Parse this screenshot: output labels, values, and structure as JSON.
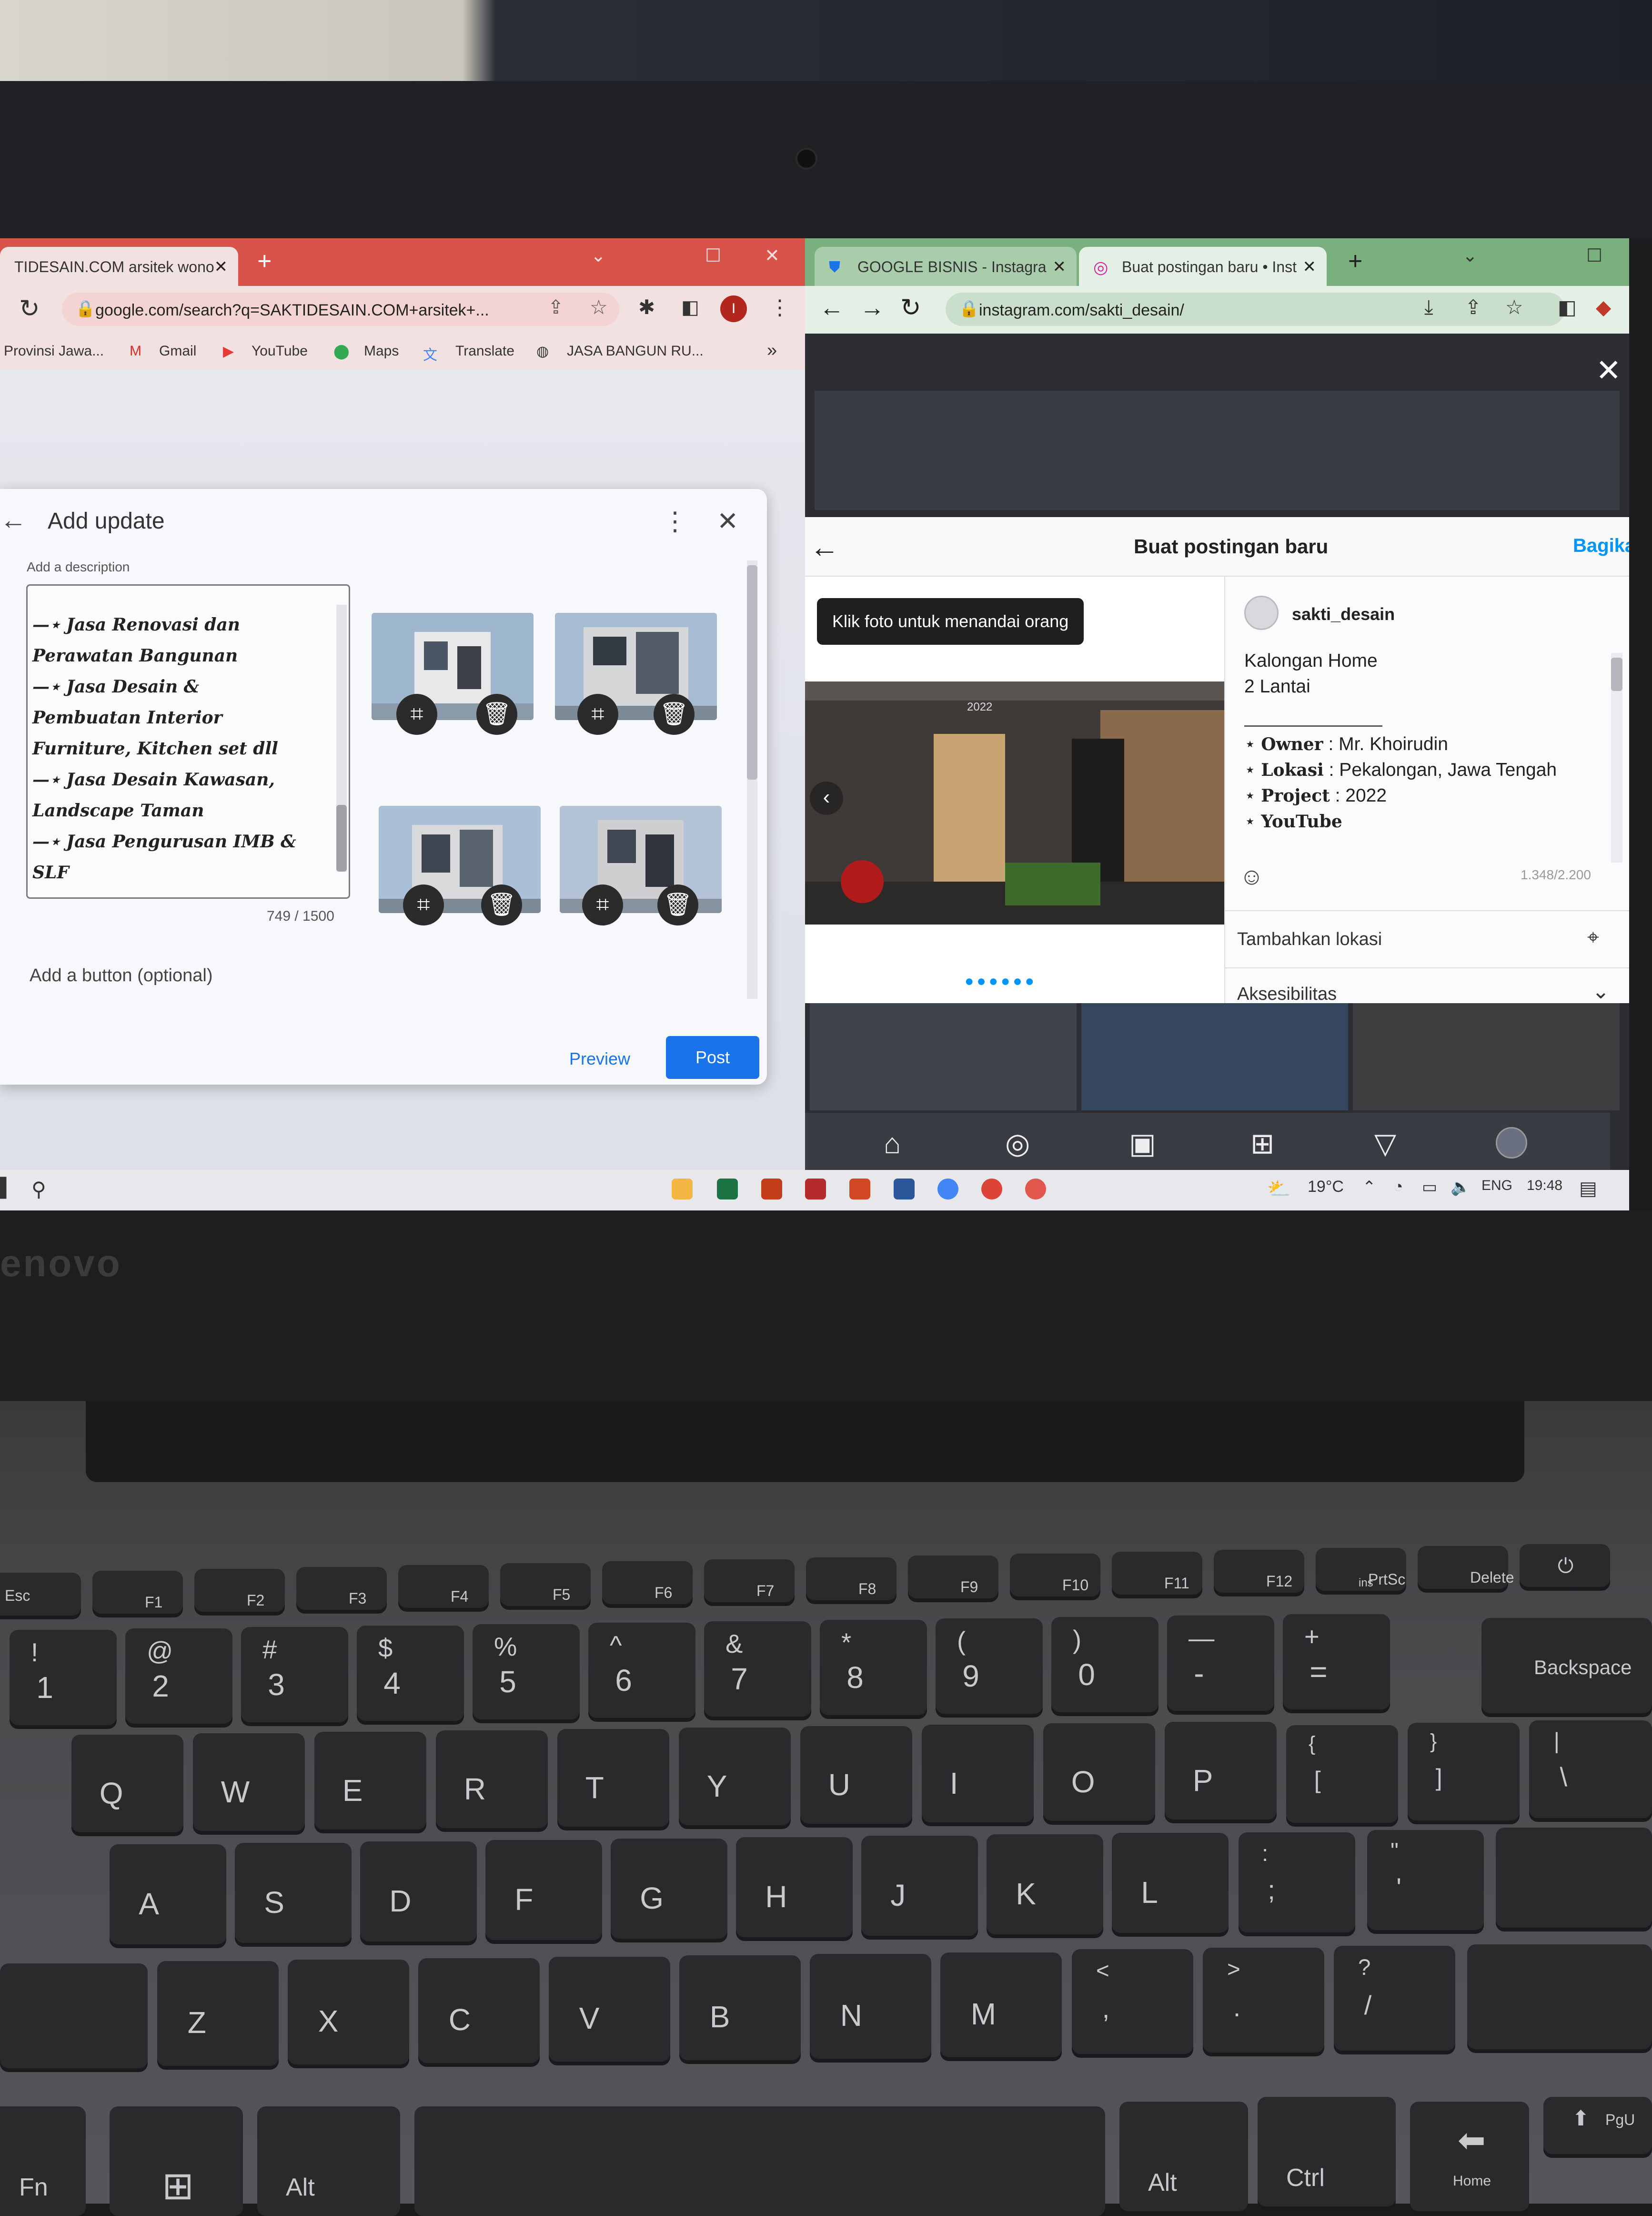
{
  "left_browser": {
    "tab_title": "TIDESAIN.COM arsitek wono",
    "address": "google.com/search?q=SAKTIDESAIN.COM+arsitek+...",
    "profile_initial": "I",
    "bookmarks": [
      "Provinsi Jawa...",
      "Gmail",
      "YouTube",
      "Maps",
      "Translate",
      "JASA BANGUN RU..."
    ],
    "bookmarks_more": "»",
    "dialog": {
      "title": "Add update",
      "description_label": "Add a description",
      "description_lines": [
        "—⋆ Jasa Renovasi dan",
        "Perawatan Bangunan",
        "—⋆ Jasa Desain &",
        "Pembuatan Interior",
        "Furniture, Kitchen set dll",
        "—⋆ Jasa Desain Kawasan,",
        "Landscape Taman",
        "—⋆ Jasa Pengurusan IMB &",
        "SLF"
      ],
      "counter": "749 / 1500",
      "button_label": "Add a button (optional)",
      "preview": "Preview",
      "post": "Post"
    }
  },
  "right_browser": {
    "tabs": [
      "GOOGLE BISNIS - Instagra",
      "Buat postingan baru • Inst"
    ],
    "address": "instagram.com/sakti_desain/",
    "modal": {
      "title": "Buat postingan baru",
      "share": "Bagikan",
      "tooltip": "Klik foto untuk menandai orang",
      "username": "sakti_desain",
      "caption_line1": "Kalongan Home",
      "caption_line2": "2 Lantai",
      "owner_label": "Owner",
      "owner_value": ": Mr. Khoirudin",
      "lokasi_label": "Lokasi",
      "lokasi_value": ": Pekalongan, Jawa Tengah",
      "project_label": "Project",
      "project_value": ": 2022",
      "youtube_label": "YouTube",
      "char_count": "1.348/2.200",
      "location": "Tambahkan lokasi",
      "accessibility": "Aksesibilitas",
      "photo_year": "2022"
    }
  },
  "taskbar": {
    "temperature": "19°C",
    "language": "ENG",
    "time": "19:48"
  },
  "laptop": {
    "brand": "enovo",
    "fkeys": [
      "Esc",
      "F1",
      "F2",
      "F3",
      "F4",
      "F5",
      "F6",
      "F7",
      "F8",
      "F9",
      "F10",
      "F11",
      "F12",
      "PrtSc",
      "Delete"
    ],
    "prtsc_sub": "ins",
    "num_top": [
      "!",
      "@",
      "#",
      "$",
      "%",
      "^",
      "&",
      "*",
      "(",
      ")",
      "—",
      "+"
    ],
    "num_bottom": [
      "1",
      "2",
      "3",
      "4",
      "5",
      "6",
      "7",
      "8",
      "9",
      "0",
      "-",
      "="
    ],
    "backspace": "Backspace",
    "row_q": [
      "Q",
      "W",
      "E",
      "R",
      "T",
      "Y",
      "U",
      "I",
      "O",
      "P"
    ],
    "bracket_top": [
      "{",
      "}"
    ],
    "bracket_bottom": [
      "[",
      "]"
    ],
    "backslash_top": "|",
    "backslash_bottom": "\\",
    "row_a": [
      "A",
      "S",
      "D",
      "F",
      "G",
      "H",
      "J",
      "K",
      "L"
    ],
    "semicolon": [
      ":",
      ";"
    ],
    "quote": [
      "\"",
      "'"
    ],
    "row_z": [
      "Z",
      "X",
      "C",
      "V",
      "B",
      "N",
      "M"
    ],
    "comma": [
      "<",
      ","
    ],
    "period": [
      ">",
      "."
    ],
    "slash": [
      "?",
      "/"
    ],
    "bottom_left": [
      "Fn",
      "Alt"
    ],
    "bottom_right": [
      "Alt",
      "Ctrl"
    ],
    "home": "Home",
    "pgup": "PgU"
  }
}
